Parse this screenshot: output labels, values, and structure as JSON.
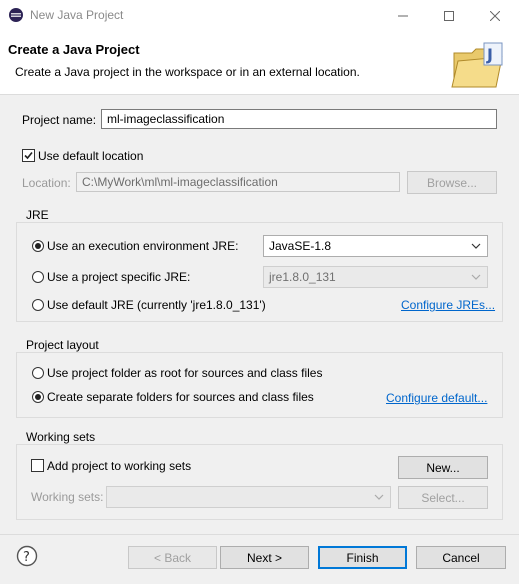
{
  "window": {
    "title": "New Java Project",
    "icons": {
      "app": "eclipse-icon",
      "minimize": "minimize-icon",
      "maximize": "maximize-icon",
      "close": "close-icon"
    }
  },
  "header": {
    "title": "Create a Java Project",
    "description": "Create a Java project in the workspace or in an external location.",
    "image": "java-project-folder-icon"
  },
  "project": {
    "name_label": "Project name:",
    "name_value": "ml-imageclassification",
    "use_default_label": "Use default location",
    "use_default_checked": true,
    "location_label": "Location:",
    "location_value": "C:\\MyWork\\ml\\ml-imageclassification",
    "browse_label": "Browse..."
  },
  "jre": {
    "group_title": "JRE",
    "env_label": "Use an execution environment JRE:",
    "env_value": "JavaSE-1.8",
    "specific_label": "Use a project specific JRE:",
    "specific_value": "jre1.8.0_131",
    "default_label": "Use default JRE (currently 'jre1.8.0_131')",
    "configure_label": "Configure JREs...",
    "selected": "env"
  },
  "layout": {
    "group_title": "Project layout",
    "root_label": "Use project folder as root for sources and class files",
    "separate_label": "Create separate folders for sources and class files",
    "configure_label": "Configure default...",
    "selected": "separate"
  },
  "working_sets": {
    "group_title": "Working sets",
    "add_label": "Add project to working sets",
    "add_checked": false,
    "new_label": "New...",
    "sets_label": "Working sets:",
    "select_label": "Select..."
  },
  "footer": {
    "help_icon": "help-icon",
    "back_label": "< Back",
    "next_label": "Next >",
    "finish_label": "Finish",
    "cancel_label": "Cancel"
  },
  "colors": {
    "accent": "#0078d7",
    "link": "#0066cc"
  }
}
